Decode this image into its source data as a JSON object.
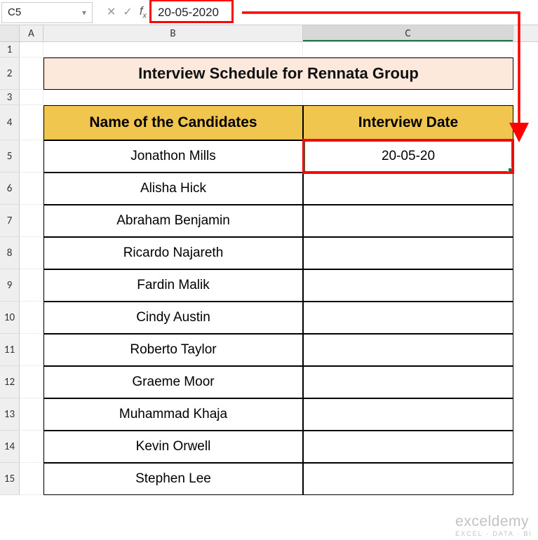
{
  "formula_bar": {
    "cell_ref": "C5",
    "formula": "20-05-2020"
  },
  "columns": {
    "A": "A",
    "B": "B",
    "C": "C"
  },
  "rows": [
    "1",
    "2",
    "3",
    "4",
    "5",
    "6",
    "7",
    "8",
    "9",
    "10",
    "11",
    "12",
    "13",
    "14",
    "15"
  ],
  "title": "Interview Schedule for Rennata Group",
  "headers": {
    "name": "Name of the Candidates",
    "date": "Interview Date"
  },
  "candidates": [
    {
      "name": "Jonathon Mills",
      "date": "20-05-20"
    },
    {
      "name": "Alisha Hick",
      "date": ""
    },
    {
      "name": "Abraham Benjamin",
      "date": ""
    },
    {
      "name": "Ricardo Najareth",
      "date": ""
    },
    {
      "name": "Fardin Malik",
      "date": ""
    },
    {
      "name": "Cindy Austin",
      "date": ""
    },
    {
      "name": "Roberto Taylor",
      "date": ""
    },
    {
      "name": "Graeme Moor",
      "date": ""
    },
    {
      "name": "Muhammad Khaja",
      "date": ""
    },
    {
      "name": "Kevin Orwell",
      "date": ""
    },
    {
      "name": "Stephen Lee",
      "date": ""
    }
  ],
  "watermark": {
    "big": "exceldemy",
    "small": "EXCEL · DATA · BI"
  }
}
